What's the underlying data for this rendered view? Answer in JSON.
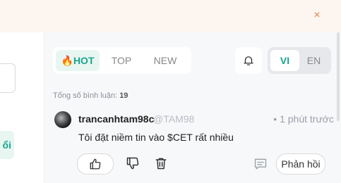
{
  "topbar": {
    "close_glyph": "×"
  },
  "left": {
    "button_label": "ổi"
  },
  "tabs": {
    "hot_emoji": "🔥",
    "hot": "HOT",
    "top": "TOP",
    "new": "NEW"
  },
  "lang": {
    "vi": "VI",
    "en": "EN",
    "active": "VI"
  },
  "comments": {
    "total_label": "Tổng số bình luận:",
    "total_count": "19",
    "item": {
      "username": "trancanhtam98c",
      "handle": "@TAM98",
      "time": "• 1 phút trước",
      "text": "Tôi đặt niềm tin vào $CET rất nhiều",
      "reply_label": "Phản hồi"
    }
  },
  "colors": {
    "accent": "#18a58a",
    "close": "#e0854a"
  },
  "icons": [
    "close-icon",
    "fire-icon",
    "bell-icon",
    "like-icon",
    "dislike-icon",
    "trash-icon",
    "message-icon"
  ]
}
